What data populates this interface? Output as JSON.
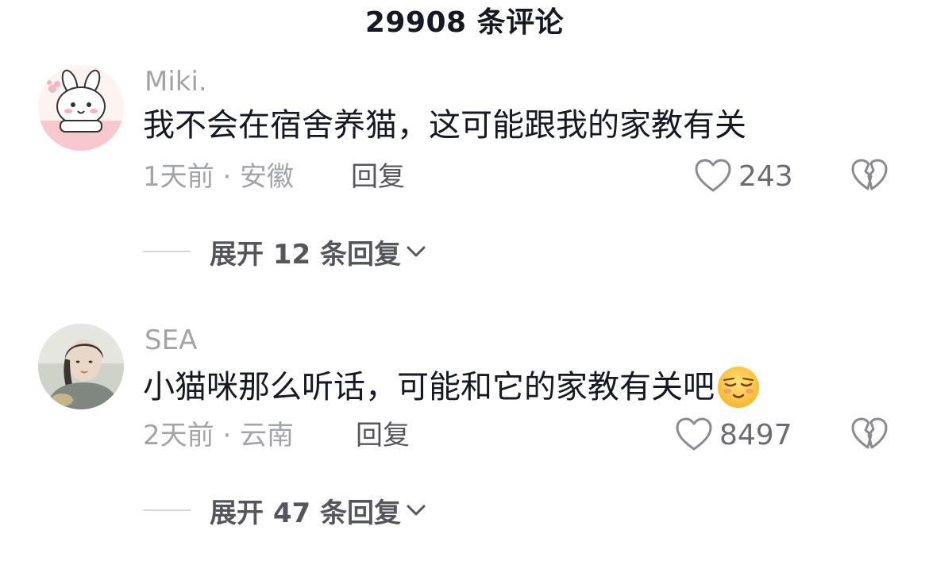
{
  "header": {
    "title": "29908 条评论"
  },
  "comments": [
    {
      "username": "Miki.",
      "text": "我不会在宿舍养猫，这可能跟我的家教有关",
      "meta": "1天前 · 安徽",
      "reply_label": "回复",
      "likes": "243",
      "expand_label": "展开 12 条回复"
    },
    {
      "username": "SEA",
      "text": "小猫咪那么听话，可能和它的家教有关吧",
      "emoji": "relieved-face-emoji",
      "meta": "2天前 · 云南",
      "reply_label": "回复",
      "likes": "8497",
      "expand_label": "展开 47 条回复"
    }
  ],
  "colors": {
    "text": "#161823",
    "secondary": "#a3a4a8",
    "action": "#55565c"
  }
}
